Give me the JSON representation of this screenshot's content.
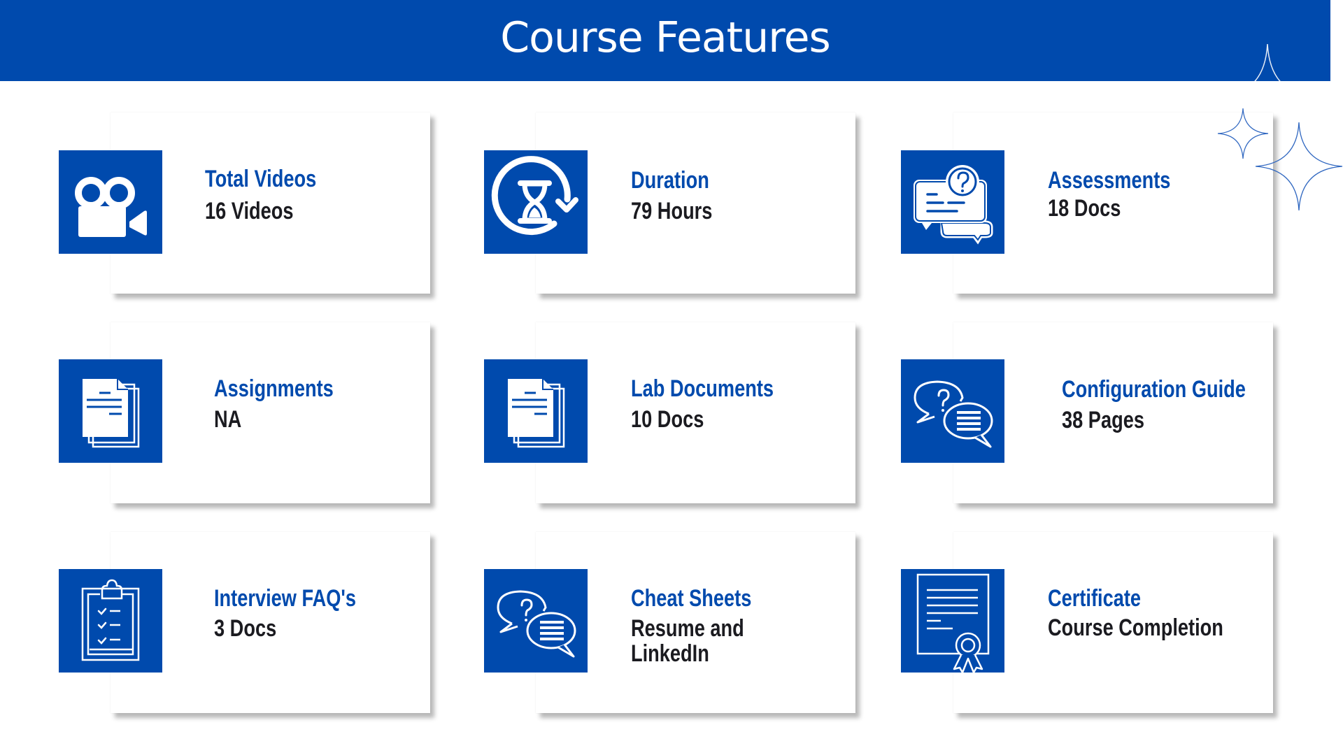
{
  "header": {
    "title": "Course Features"
  },
  "colors": {
    "brand_blue": "#004AAD",
    "value_text": "#1B1B20",
    "background": "#FFFFFF"
  },
  "features": [
    {
      "title": "Total Videos",
      "value": "16 Videos",
      "icon": "video-camera-icon"
    },
    {
      "title": "Duration",
      "value": "79 Hours",
      "icon": "hourglass-refresh-icon"
    },
    {
      "title": "Assessments",
      "value": "18 Docs",
      "icon": "chat-question-icon"
    },
    {
      "title": "Assignments",
      "value": "NA",
      "icon": "documents-icon"
    },
    {
      "title": "Lab Documents",
      "value": "10 Docs",
      "icon": "documents-icon"
    },
    {
      "title": "Configuration Guide",
      "value": "38 Pages",
      "icon": "speech-bubbles-icon"
    },
    {
      "title": "Interview FAQ's",
      "value": "3 Docs",
      "icon": "clipboard-checklist-icon"
    },
    {
      "title": "Cheat Sheets",
      "value": "Resume and\nLinkedIn",
      "icon": "speech-bubbles-icon"
    },
    {
      "title": "Certificate",
      "value": "Course Completion",
      "icon": "certificate-icon"
    }
  ]
}
